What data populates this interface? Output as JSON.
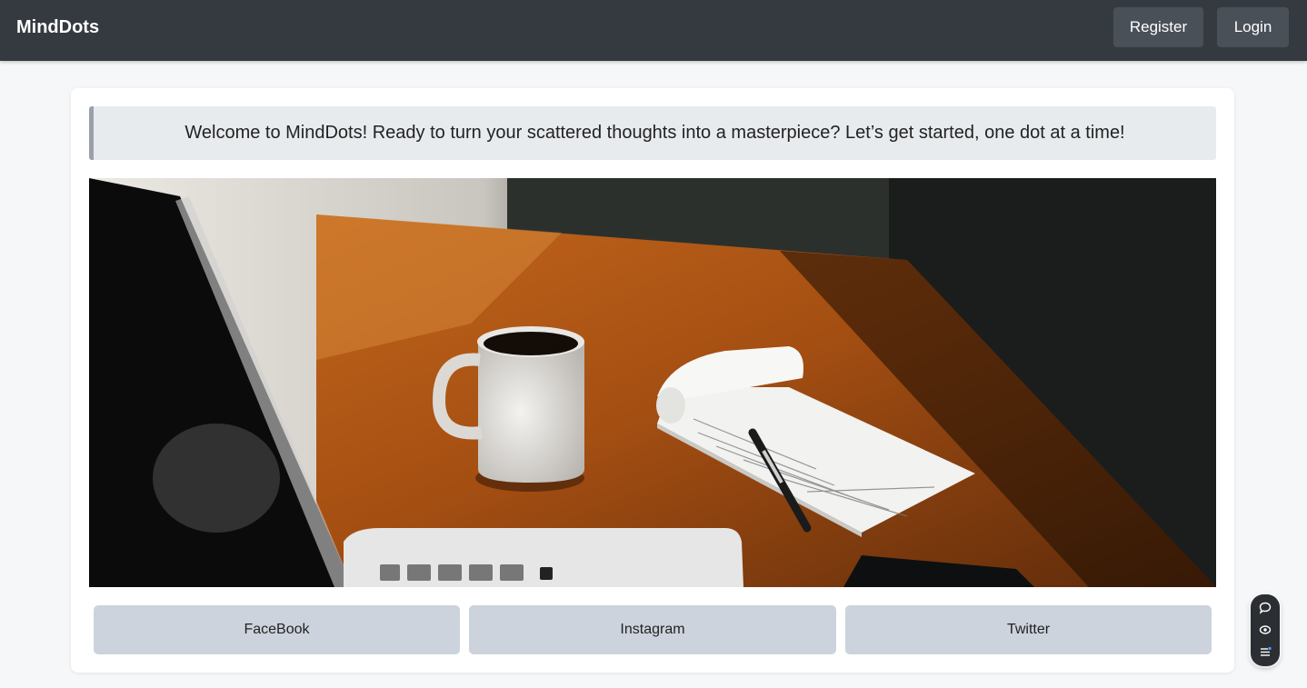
{
  "header": {
    "brand": "MindDots",
    "register_label": "Register",
    "login_label": "Login"
  },
  "main": {
    "welcome_text": "Welcome to MindDots! Ready to turn your scattered thoughts into a masterpiece? Let’s get started, one dot at a time!",
    "hero_image": "desk-with-coffee-mug-notepad-pen-laptop",
    "social_links": [
      "FaceBook",
      "Instagram",
      "Twitter"
    ]
  },
  "floating_toolbar": {
    "icons": [
      "chat-icon",
      "eye-icon",
      "list-icon"
    ]
  },
  "colors": {
    "navbar": "#343a40",
    "nav_button": "#4a5058",
    "page_background": "#f6f7f8",
    "welcome_background": "#e8ebee",
    "social_button": "#cdd3dc"
  }
}
